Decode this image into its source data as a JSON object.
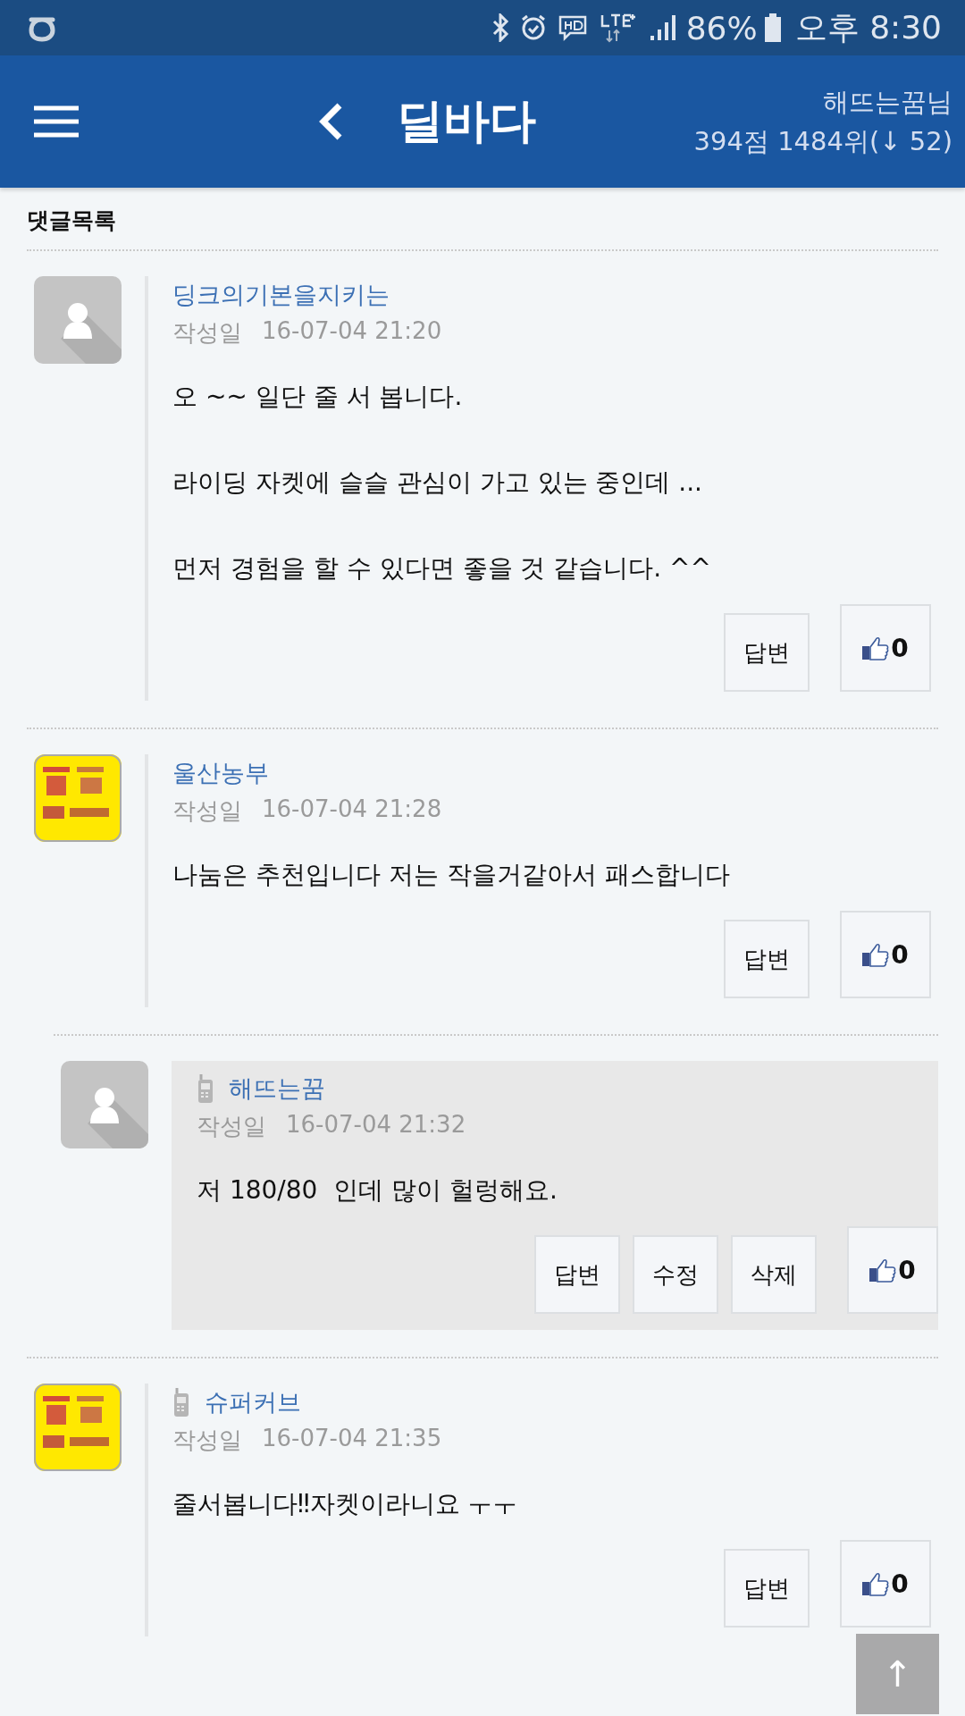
{
  "status_bar": {
    "battery": "86%",
    "time": "오후 8:30"
  },
  "header": {
    "title": "딜바다",
    "user": "해뜨는꿈님",
    "rank": "394점 1484위(↓ 52)"
  },
  "section_title": "댓글목록",
  "comments": [
    {
      "author": "딩크의기본을지키는",
      "mobile": false,
      "reply": false,
      "avatar": {
        "kind": "default"
      },
      "date_label": "작성일",
      "date": "16-07-04 21:20",
      "paragraphs": [
        "오 ~~ 일단 줄 서 봅니다.",
        "라이딩 자켓에 슬슬 관심이 가고 있는 중인데 ...",
        "먼저 경험을 할 수 있다면 좋을 것 같습니다. ^^"
      ],
      "buttons": [
        "답변"
      ],
      "likes": "0"
    },
    {
      "author": "울산농부",
      "mobile": false,
      "reply": false,
      "date_label": "작성일",
      "date": "16-07-04 21:28",
      "paragraphs": [
        "나눔은 추천입니다 저는 작을거같아서 패스합니다"
      ],
      "buttons": [
        "답변"
      ],
      "likes": "0"
    },
    {
      "author": "해뜨는꿈",
      "mobile": true,
      "reply": true,
      "avatar": {
        "kind": "default"
      },
      "date_label": "작성일",
      "date": "16-07-04 21:32",
      "paragraphs": [
        "저 180/80  인데 많이 헐렁해요."
      ],
      "buttons": [
        "답변",
        "수정",
        "삭제"
      ],
      "likes": "0"
    },
    {
      "author": "슈퍼커브",
      "mobile": true,
      "reply": false,
      "date_label": "작성일",
      "date": "16-07-04 21:35",
      "paragraphs": [
        "줄서봅니다‼자켓이라니요 ㅜㅜ"
      ],
      "buttons": [
        "답변"
      ],
      "likes": "0"
    }
  ],
  "scroll_top": "↑"
}
